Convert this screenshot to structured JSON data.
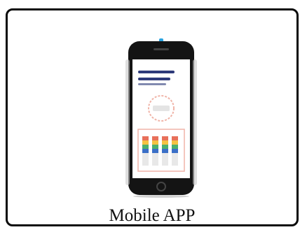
{
  "card": {
    "caption": "Mobile APP"
  },
  "phone": {
    "icon": "smartphone-icon",
    "screen": {
      "heading_lines": 2,
      "chart_bars": 4
    }
  },
  "colors": {
    "border": "#0a0a0a",
    "phone_body": "#141414",
    "accent_blue": "#29a3e0",
    "screen_heading": "#2d3a7a",
    "accent_pink": "#f0b4a8"
  }
}
